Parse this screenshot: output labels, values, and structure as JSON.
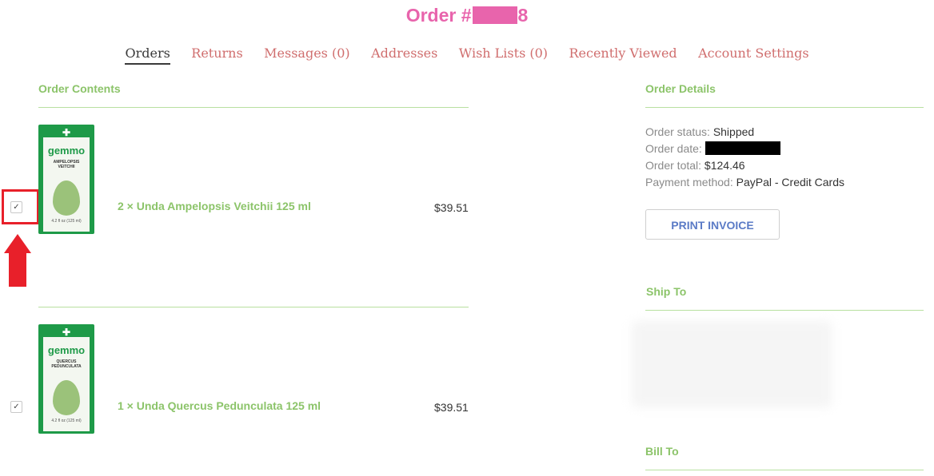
{
  "header": {
    "title_prefix": "Order #",
    "title_suffix": "8"
  },
  "nav": {
    "items": [
      {
        "label": "Orders",
        "active": true
      },
      {
        "label": "Returns"
      },
      {
        "label": "Messages (0)"
      },
      {
        "label": "Addresses"
      },
      {
        "label": "Wish Lists (0)"
      },
      {
        "label": "Recently Viewed"
      },
      {
        "label": "Account Settings"
      }
    ]
  },
  "order_contents": {
    "heading": "Order Contents",
    "items": [
      {
        "quantity_name": "2 × Unda Ampelopsis Veitchii 125 ml",
        "price": "$39.51",
        "checked": true,
        "image": {
          "brand": "gemmo",
          "label": "AMPELOPSIS VEITCHII",
          "volume": "4.2 fl oz (125 ml)"
        }
      },
      {
        "quantity_name": "1 × Unda Quercus Pedunculata 125 ml",
        "price": "$39.51",
        "checked": true,
        "image": {
          "brand": "gemmo",
          "label": "QUERCUS PEDUNCULATA",
          "volume": "4.2 fl oz (125 ml)"
        }
      }
    ]
  },
  "order_details": {
    "heading": "Order Details",
    "status_label": "Order status:",
    "status_value": "Shipped",
    "date_label": "Order date:",
    "total_label": "Order total:",
    "total_value": "$124.46",
    "payment_label": "Payment method:",
    "payment_value": "PayPal - Credit Cards",
    "print_button": "PRINT INVOICE"
  },
  "ship_to": {
    "heading": "Ship To"
  },
  "bill_to": {
    "heading": "Bill To"
  },
  "colors": {
    "accent_pink": "#e864ac",
    "accent_green": "#8cc46a",
    "nav_link": "#d06e6e",
    "highlight_red": "#e8202a",
    "button_text": "#5b7bc6"
  },
  "icons": {
    "check": "✓",
    "cross": "✚"
  }
}
